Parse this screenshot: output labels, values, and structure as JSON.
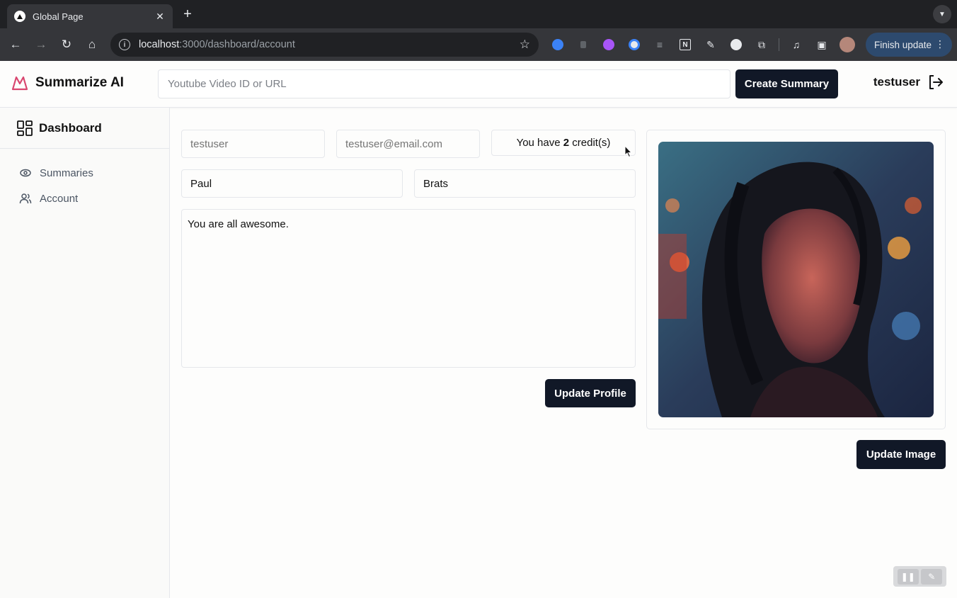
{
  "browser": {
    "tab_title": "Global Page",
    "url_host": "localhost",
    "url_path": ":3000/dashboard/account",
    "finish_update_label": "Finish update"
  },
  "header": {
    "brand": "Summarize AI",
    "search_placeholder": "Youtube Video ID or URL",
    "create_button": "Create Summary",
    "username": "testuser"
  },
  "sidebar": {
    "title": "Dashboard",
    "items": [
      {
        "label": "Summaries",
        "icon": "eye-icon"
      },
      {
        "label": "Account",
        "icon": "users-icon"
      }
    ]
  },
  "profile": {
    "username_placeholder": "testuser",
    "email_placeholder": "testuser@email.com",
    "credits_prefix": "You have ",
    "credits_count": "2",
    "credits_suffix": " credit(s)",
    "first_name": "Paul",
    "last_name": "Brats",
    "bio": "You are all awesome.",
    "update_profile_button": "Update Profile",
    "update_image_button": "Update Image"
  },
  "colors": {
    "brand_accent": "#d9466f",
    "button_dark": "#111827",
    "browser_dark": "#202124",
    "update_pill": "#2d4a6e"
  }
}
